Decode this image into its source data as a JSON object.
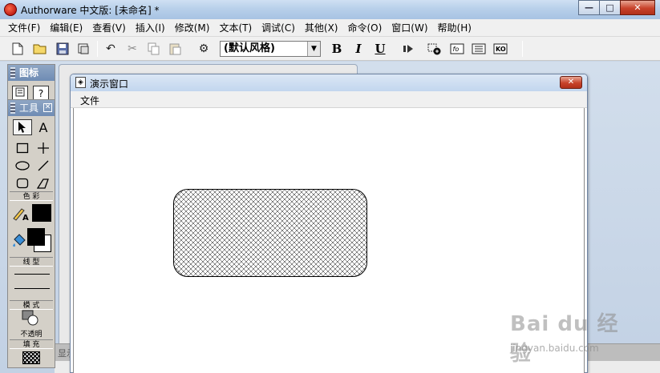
{
  "window": {
    "title": "Authorware 中文版: [未命名] *",
    "minimize_label": "—",
    "maximize_label": "□",
    "close_label": "✕"
  },
  "menubar": {
    "items": [
      {
        "label": "文件(F)"
      },
      {
        "label": "编辑(E)"
      },
      {
        "label": "查看(V)"
      },
      {
        "label": "插入(I)"
      },
      {
        "label": "修改(M)"
      },
      {
        "label": "文本(T)"
      },
      {
        "label": "调试(C)"
      },
      {
        "label": "其他(X)"
      },
      {
        "label": "命令(O)"
      },
      {
        "label": "窗口(W)"
      },
      {
        "label": "帮助(H)"
      }
    ]
  },
  "toolbar": {
    "style_select_value": "(默认风格)",
    "bold_label": "B",
    "italic_label": "I",
    "underline_label": "U"
  },
  "icon_palette": {
    "title": "图标"
  },
  "tools_panel": {
    "title": "工具",
    "text_tool_label": "A",
    "color_section_label": "色 彩",
    "line_section_label": "线 型",
    "mode_section_label": "模 式",
    "mode_value": "不透明",
    "fill_section_label": "填 充"
  },
  "presentation_window": {
    "title": "演示窗口",
    "menu_file": "文件",
    "close_label": "✕"
  },
  "bottom_strip": {
    "label": "显示"
  },
  "watermark": {
    "brand": "Bai du 经验",
    "url": "jingyan.baidu.com"
  },
  "colors": {
    "accent_titlebar": "#b8d0ea",
    "close_button": "#c7422a",
    "panel_bg": "#d4d0c8"
  }
}
